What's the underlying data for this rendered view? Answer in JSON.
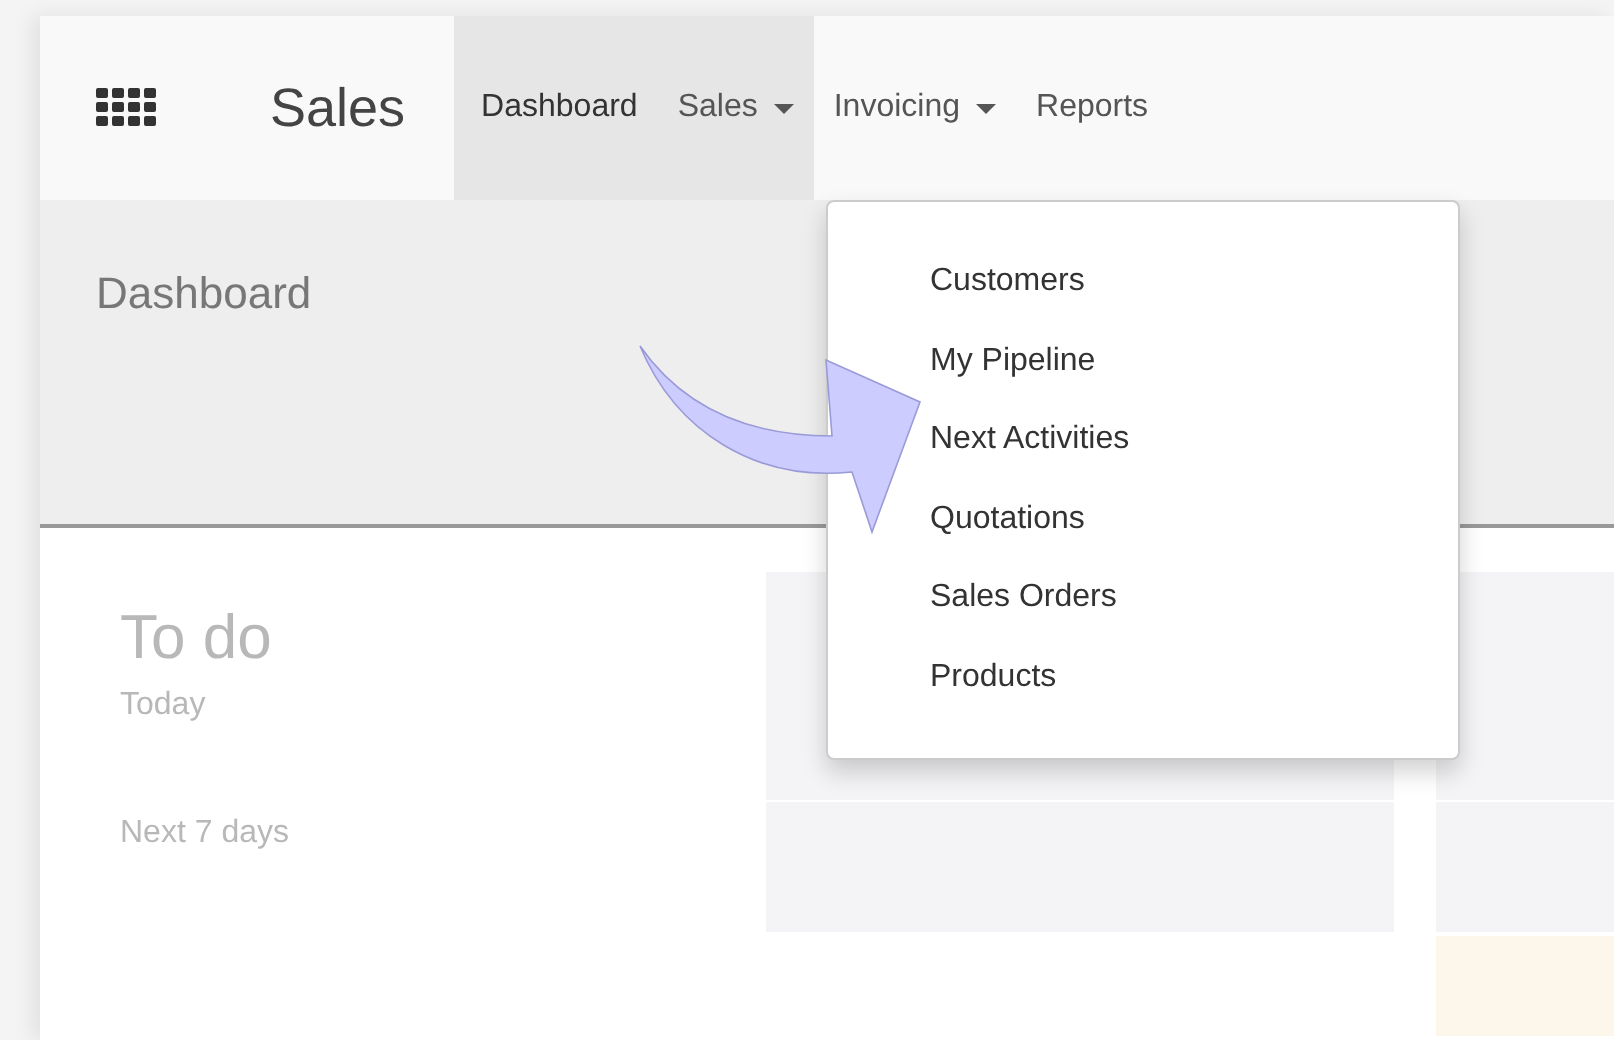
{
  "navbar": {
    "app_title": "Sales",
    "menu": [
      {
        "label": "Dashboard",
        "selected": true,
        "kind": "link"
      },
      {
        "label": "Sales",
        "selected": false,
        "expanded": true,
        "kind": "dropdown"
      },
      {
        "label": "Invoicing",
        "selected": false,
        "expanded": false,
        "kind": "dropdown"
      },
      {
        "label": "Reports",
        "selected": false,
        "kind": "link"
      }
    ]
  },
  "dropdown": {
    "items": [
      "Customers",
      "My Pipeline",
      "Next Activities",
      "Quotations",
      "Sales Orders",
      "Products"
    ]
  },
  "control_panel": {
    "title": "Dashboard"
  },
  "todo": {
    "title": "To do",
    "rows": [
      "Today",
      "Next 7 days"
    ]
  }
}
